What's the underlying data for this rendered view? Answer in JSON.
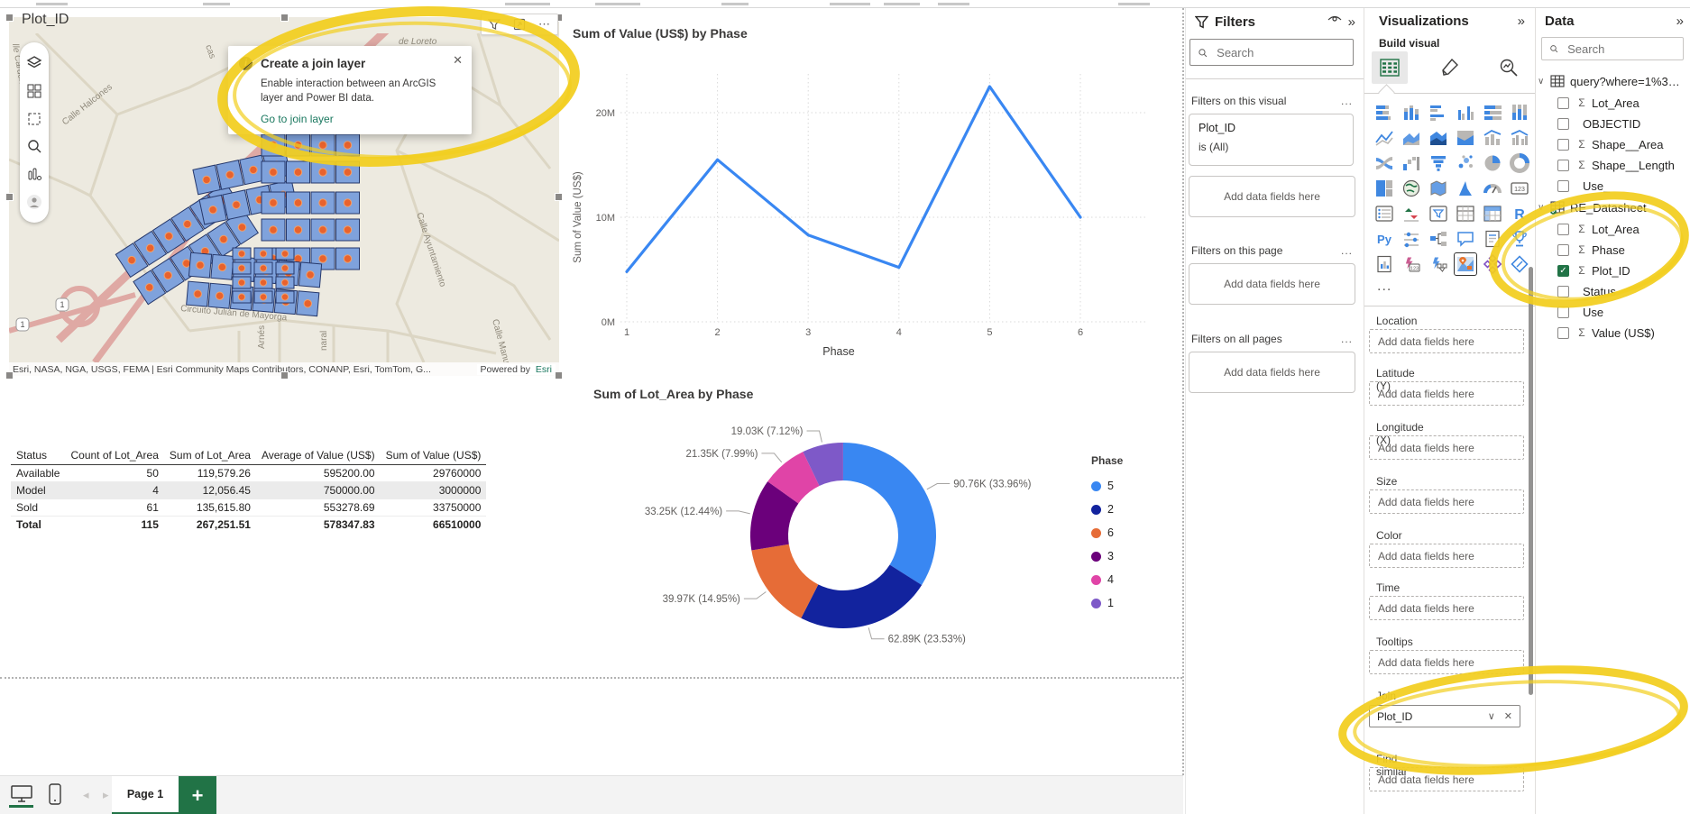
{
  "app": {
    "accent_green": "#217346",
    "annotation_yellow": "#F2CE1E",
    "link_teal": "#1A785F"
  },
  "map_visual": {
    "title": "Plot_ID",
    "header_icons": [
      "filter-icon",
      "focus-mode-icon",
      "more-options-icon"
    ],
    "callout": {
      "title": "Create a join layer",
      "body": "Enable interaction between an ArcGIS layer and Power BI data.",
      "link": "Go to join layer"
    },
    "street_labels": {
      "top_right": "de Loreto",
      "upper_left": "Calle Halcones",
      "left_edge": "lle Cardenas",
      "top_partial": "cas",
      "right_vertical": "Calle Ayuntamiento",
      "right_lower": "Calle Manue",
      "bottom_curve": "Circuito Julián de Mayorga",
      "bottom_vertical_1": "Arnés",
      "bottom_vertical_2": "naral"
    },
    "highway_shield": "1",
    "attribution": "Esri, NASA, NGA, USGS, FEMA | Esri Community Maps Contributors, CONANP, Esri, TomTom, G...",
    "powered_by_prefix": "Powered by",
    "powered_by_brand": "Esri"
  },
  "chart_data": [
    {
      "type": "line",
      "title": "Sum of Value (US$) by Phase",
      "xlabel": "Phase",
      "ylabel": "Sum of Value (US$)",
      "x": [
        1,
        2,
        3,
        4,
        5,
        6
      ],
      "values_millions": [
        4.8,
        15.5,
        8.3,
        5.2,
        22.5,
        10.0
      ],
      "yticks": [
        {
          "label": "0M",
          "value": 0
        },
        {
          "label": "10M",
          "value": 10
        },
        {
          "label": "20M",
          "value": 20
        }
      ],
      "ylim": [
        0,
        26
      ],
      "grid": true,
      "legend": false,
      "line_color": "#3987F2"
    },
    {
      "type": "donut",
      "title": "Sum of Lot_Area by Phase",
      "legend_title": "Phase",
      "legend_position": "right",
      "slices": [
        {
          "name": "5",
          "value_k": 90.76,
          "pct": 33.96,
          "label": "90.76K (33.96%)",
          "color": "#3987F2"
        },
        {
          "name": "2",
          "value_k": 62.89,
          "pct": 23.53,
          "label": "62.89K (23.53%)",
          "color": "#12239E"
        },
        {
          "name": "6",
          "value_k": 39.97,
          "pct": 14.95,
          "label": "39.97K (14.95%)",
          "color": "#E66C37"
        },
        {
          "name": "3",
          "value_k": 33.25,
          "pct": 12.44,
          "label": "33.25K (12.44%)",
          "color": "#6B007B"
        },
        {
          "name": "4",
          "value_k": 21.35,
          "pct": 7.99,
          "label": "21.35K (7.99%)",
          "color": "#E044A7"
        },
        {
          "name": "1",
          "value_k": 19.03,
          "pct": 7.12,
          "label": "19.03K (7.12%)",
          "color": "#7E59C8"
        }
      ]
    },
    {
      "type": "table",
      "headers": [
        "Status",
        "Count of Lot_Area",
        "Sum of Lot_Area",
        "Average of Value (US$)",
        "Sum of Value (US$)"
      ],
      "rows": [
        [
          "Available",
          "50",
          "119,579.26",
          "595200.00",
          "29760000"
        ],
        [
          "Model",
          "4",
          "12,056.45",
          "750000.00",
          "3000000"
        ],
        [
          "Sold",
          "61",
          "135,615.80",
          "553278.69",
          "33750000"
        ]
      ],
      "total": [
        "Total",
        "115",
        "267,251.51",
        "578347.83",
        "66510000"
      ]
    }
  ],
  "filters_pane": {
    "title": "Filters",
    "search_placeholder": "Search",
    "sections": [
      {
        "label": "Filters on this visual",
        "more": "...",
        "card": {
          "field": "Plot_ID",
          "condition": "is (All)"
        },
        "add_hint": "Add data fields here"
      },
      {
        "label": "Filters on this page",
        "more": "...",
        "add_hint": "Add data fields here"
      },
      {
        "label": "Filters on all pages",
        "more": "...",
        "add_hint": "Add data fields here"
      }
    ]
  },
  "visualizations_pane": {
    "title": "Visualizations",
    "build_label": "Build visual",
    "tabs": [
      "build-visual-tab",
      "format-visual-tab",
      "analytics-tab"
    ],
    "icon_grid": [
      "stacked-bar-chart",
      "stacked-column-chart",
      "clustered-bar-chart",
      "clustered-column-chart",
      "hundred-stacked-bar-chart",
      "hundred-stacked-column-chart",
      "line-chart",
      "area-chart",
      "stacked-area-chart",
      "hundred-stacked-area-chart",
      "line-and-stacked-column-chart",
      "line-and-clustered-column-chart",
      "ribbon-chart",
      "waterfall-chart",
      "funnel-chart",
      "scatter-chart",
      "pie-chart",
      "donut-chart",
      "treemap",
      "map",
      "filled-map",
      "azure-map",
      "gauge",
      "card",
      "multi-row-card",
      "kpi",
      "slicer",
      "table",
      "matrix",
      "r-script-visual",
      "python-visual",
      "key-influencers",
      "decomposition-tree",
      "q-and-a",
      "smart-narrative",
      "metrics",
      "paginated-report",
      "power-apps-visual",
      "power-automate-visual",
      "arcgis-map",
      "esri-custom-visual",
      "custom-visual"
    ],
    "selected_icon": "arcgis-map",
    "more_label": "...",
    "wells": [
      {
        "label": "Location",
        "hint": "Add data fields here"
      },
      {
        "label": "Latitude (Y)",
        "hint": "Add data fields here"
      },
      {
        "label": "Longitude (X)",
        "hint": "Add data fields here"
      },
      {
        "label": "Size",
        "hint": "Add data fields here"
      },
      {
        "label": "Color",
        "hint": "Add data fields here"
      },
      {
        "label": "Time",
        "hint": "Add data fields here"
      },
      {
        "label": "Tooltips",
        "hint": "Add data fields here"
      },
      {
        "label": "Join layer",
        "type": "dropdown",
        "value": "Plot_ID"
      },
      {
        "label": "Find similar",
        "hint": "Add data fields here"
      }
    ]
  },
  "data_pane": {
    "title": "Data",
    "search_placeholder": "Search",
    "tables": [
      {
        "name": "query?where=1%3D1...",
        "expanded": true,
        "badge": false,
        "fields": [
          {
            "name": "Lot_Area",
            "numeric": true,
            "checked": false
          },
          {
            "name": "OBJECTID",
            "numeric": false,
            "checked": false
          },
          {
            "name": "Shape__Area",
            "numeric": true,
            "checked": false
          },
          {
            "name": "Shape__Length",
            "numeric": true,
            "checked": false
          },
          {
            "name": "Use_",
            "numeric": false,
            "checked": false
          }
        ]
      },
      {
        "name": "RE_Datasheet",
        "expanded": true,
        "badge": true,
        "fields": [
          {
            "name": "Lot_Area",
            "numeric": true,
            "checked": false
          },
          {
            "name": "Phase",
            "numeric": true,
            "checked": false
          },
          {
            "name": "Plot_ID",
            "numeric": true,
            "checked": true
          },
          {
            "name": "Status",
            "numeric": false,
            "checked": false
          },
          {
            "name": "Use",
            "numeric": false,
            "checked": false
          },
          {
            "name": "Value (US$)",
            "numeric": true,
            "checked": false
          }
        ]
      }
    ]
  },
  "bottom_bar": {
    "page_tab": "Page 1"
  }
}
